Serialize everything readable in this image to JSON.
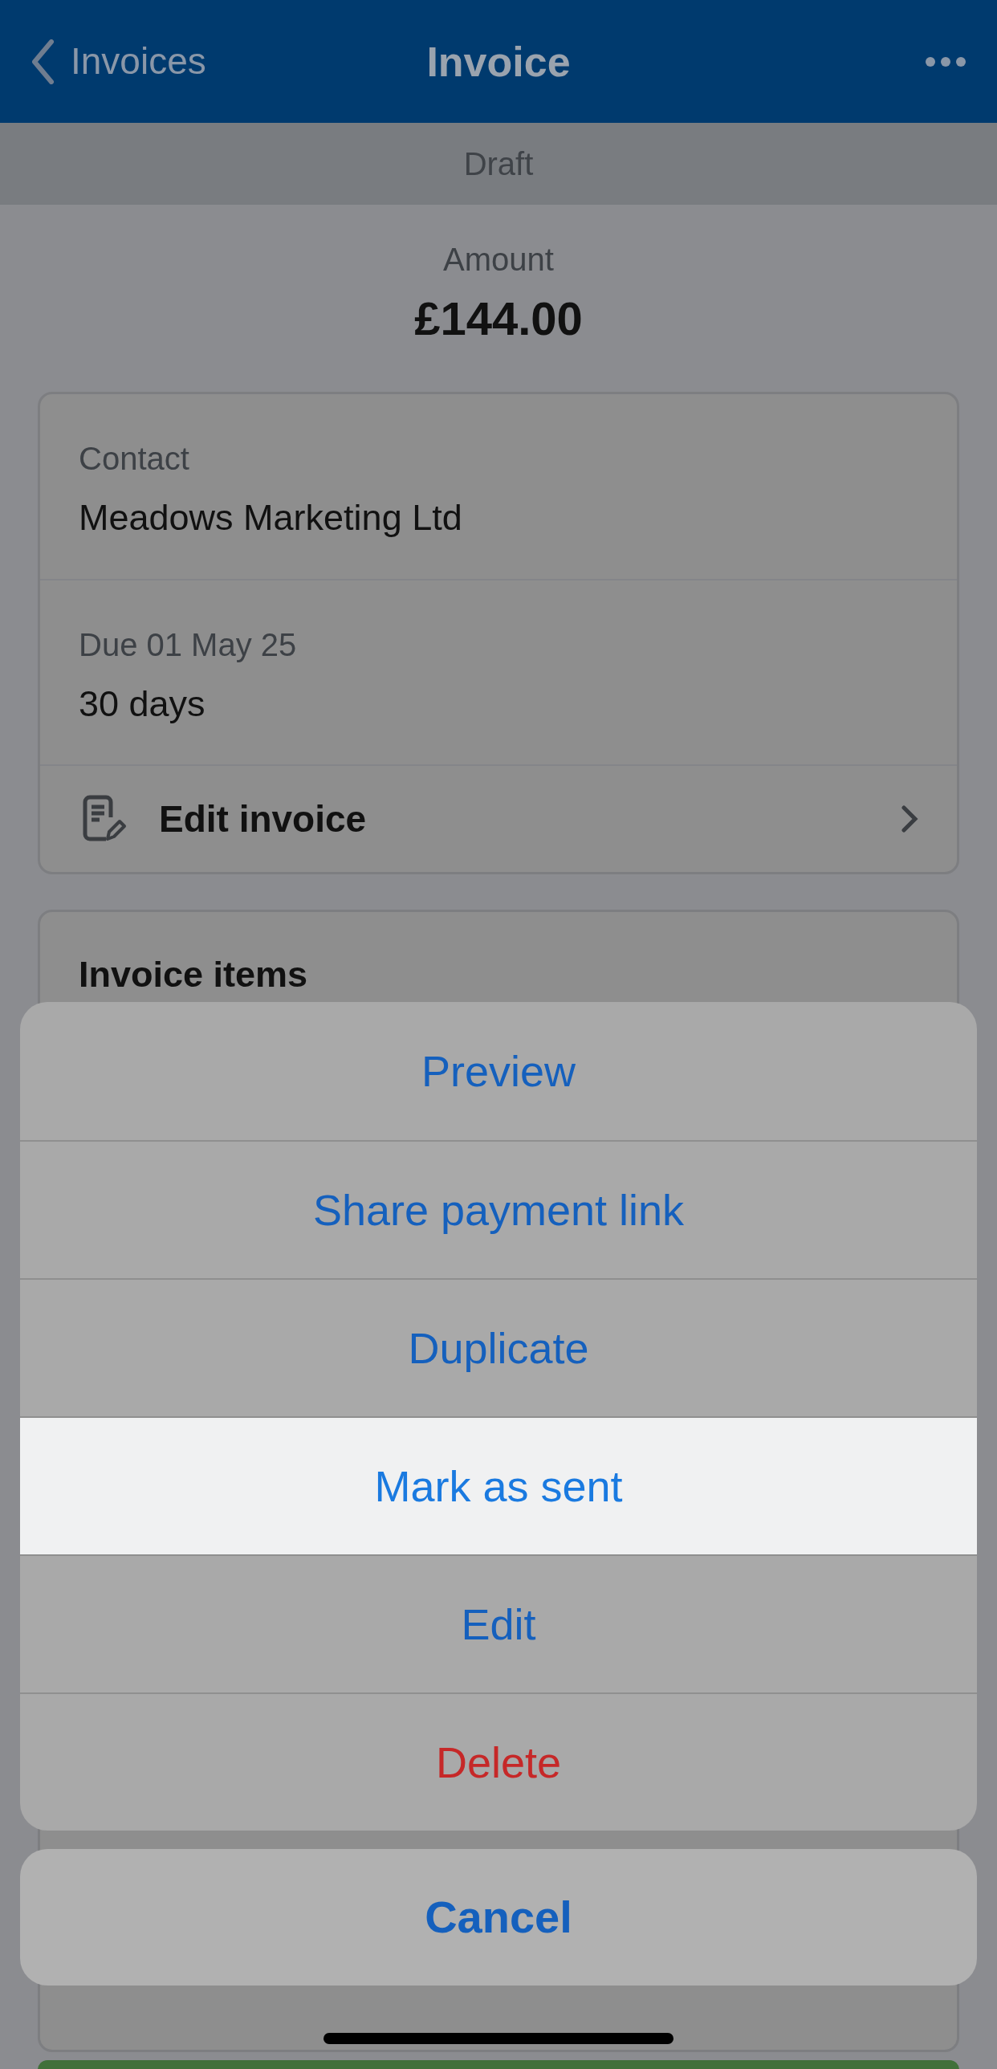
{
  "nav": {
    "back": "Invoices",
    "title": "Invoice"
  },
  "status": "Draft",
  "amount": {
    "label": "Amount",
    "value": "£144.00"
  },
  "details": [
    {
      "label": "Contact",
      "value": "Meadows Marketing Ltd"
    },
    {
      "label": "Due 01 May 25",
      "value": "30 days"
    }
  ],
  "edit_link": "Edit invoice",
  "items_card": {
    "title": "Invoice items"
  },
  "actions": [
    {
      "label": "Preview",
      "kind": "default",
      "selected": false
    },
    {
      "label": "Share payment link",
      "kind": "default",
      "selected": false
    },
    {
      "label": "Duplicate",
      "kind": "default",
      "selected": false
    },
    {
      "label": "Mark as sent",
      "kind": "default",
      "selected": true
    },
    {
      "label": "Edit",
      "kind": "default",
      "selected": false
    },
    {
      "label": "Delete",
      "kind": "destructive",
      "selected": false
    }
  ],
  "cancel": "Cancel"
}
